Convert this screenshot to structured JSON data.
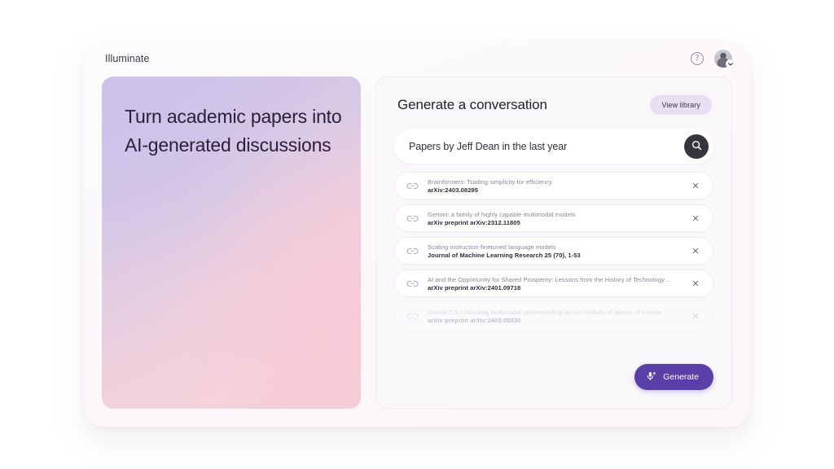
{
  "topbar": {
    "brand": "Illuminate",
    "help_icon": "question-mark-icon",
    "avatar_icon": "user-avatar",
    "avatar_chevron": "chevron-down-icon"
  },
  "hero": {
    "title": "Turn academic papers into AI-generated discussions",
    "gradient_from": "#c7bee8",
    "gradient_to": "#f2ccd4"
  },
  "panel": {
    "title": "Generate a conversation",
    "view_library_label": "View library"
  },
  "search": {
    "value": "Papers by Jeff Dean in the last year",
    "placeholder": "Search for papers",
    "button_icon": "search-icon",
    "button_color": "#35353c"
  },
  "results": [
    {
      "title": "Brainformers: Trading simplicity for efficiency",
      "citation": "arXiv:2403.08295",
      "link_icon": "link-icon",
      "remove_icon": "close-icon",
      "faded": false
    },
    {
      "title": "Gemini: a family of highly capable multimodal models",
      "citation": "arXiv preprint arXiv:2312.11805",
      "link_icon": "link-icon",
      "remove_icon": "close-icon",
      "faded": false
    },
    {
      "title": "Scaling instruction-finetuned language models",
      "citation": "Journal of Machine Learning Research 25 (70), 1-53",
      "link_icon": "link-icon",
      "remove_icon": "close-icon",
      "faded": false
    },
    {
      "title": "AI and the Opportunity for Shared Prosperity: Lessons from the History of Technology…",
      "citation": "arXiv preprint arXiv:2401.09718",
      "link_icon": "link-icon",
      "remove_icon": "close-icon",
      "faded": false
    },
    {
      "title": "Gemini 1.5: Unlocking multimodal understanding across millions of tokens of context",
      "citation": "arXiv preprint arXiv:2403.05530",
      "link_icon": "link-icon",
      "remove_icon": "close-icon",
      "faded": true
    }
  ],
  "generate": {
    "label": "Generate",
    "icon": "mic-sparkle-icon",
    "color": "#5b3fa8"
  }
}
